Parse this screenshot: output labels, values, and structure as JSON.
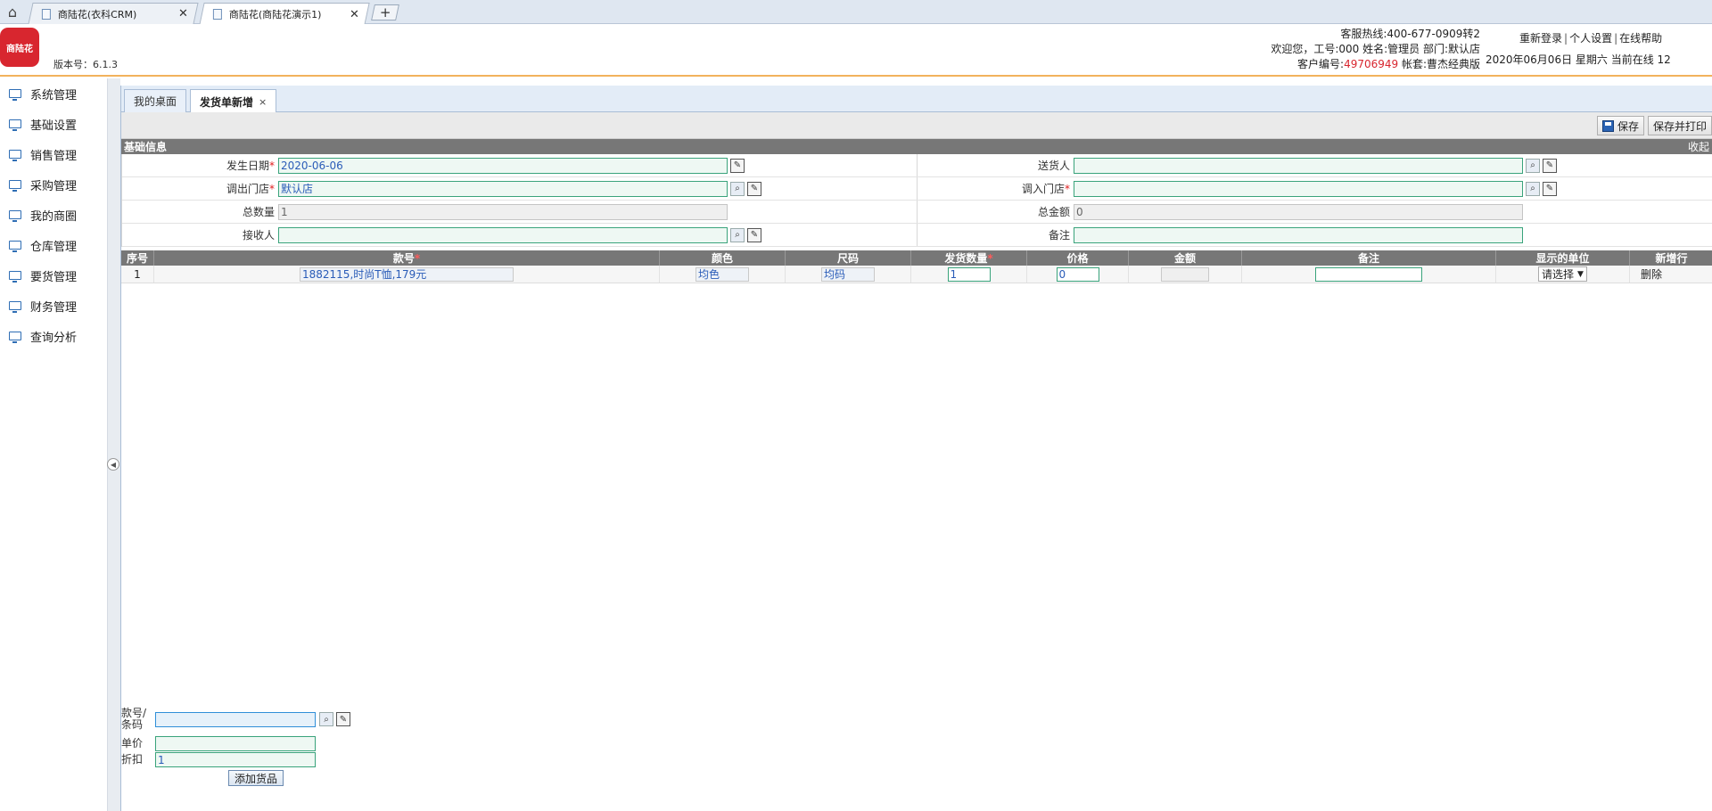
{
  "browser": {
    "tabs": [
      {
        "title": "商陆花(衣科CRM)"
      },
      {
        "title": "商陆花(商陆花演示1)"
      }
    ],
    "new_tab": "+"
  },
  "header": {
    "logo_text": "商陆花",
    "version": "版本号：6.1.3",
    "hotline": "客服热线:400-677-0909转2",
    "welcome": "欢迎您，工号:000 姓名:管理员 部门:默认店",
    "customer_no_label": "客户编号:",
    "customer_no": "49706949",
    "account": " 帐套:曹杰经典版",
    "links": [
      "重新登录",
      "个人设置",
      "在线帮助"
    ],
    "date_line": "2020年06月06日 星期六 当前在线 12"
  },
  "sidebar": {
    "items": [
      "系统管理",
      "基础设置",
      "销售管理",
      "采购管理",
      "我的商圈",
      "仓库管理",
      "要货管理",
      "财务管理",
      "查询分析"
    ]
  },
  "content_tabs": [
    {
      "label": "我的桌面"
    },
    {
      "label": "发货单新增",
      "close": "×"
    }
  ],
  "toolbar": {
    "save_label": "保存",
    "save_print_label": "保存并打印"
  },
  "section": {
    "title": "基础信息",
    "collapse": "收起"
  },
  "form": {
    "date_label": "发生日期",
    "date_value": "2020-06-06",
    "sender_label": "送货人",
    "sender_value": "",
    "out_store_label": "调出门店",
    "out_store_value": "默认店",
    "in_store_label": "调入门店",
    "in_store_value": "",
    "total_qty_label": "总数量",
    "total_qty_value": "1",
    "total_amount_label": "总金额",
    "total_amount_value": "0",
    "receiver_label": "接收人",
    "receiver_value": "",
    "remark_label": "备注",
    "remark_value": "",
    "required_mark": "*"
  },
  "grid": {
    "headers": {
      "seq": "序号",
      "style": "款号",
      "color": "颜色",
      "size": "尺码",
      "qty": "发货数量",
      "price": "价格",
      "amount": "金额",
      "remark": "备注",
      "unit": "显示的单位",
      "addrow": "新增行"
    },
    "rows": [
      {
        "seq": "1",
        "style": "1882115,时尚T恤,179元",
        "color": "均色",
        "size": "均码",
        "qty": "1",
        "price": "0",
        "amount": "",
        "remark": "",
        "unit": "请选择",
        "action": "删除"
      }
    ]
  },
  "add_panel": {
    "code_label": "款号/条码",
    "code_value": "",
    "price_label": "单价",
    "price_value": "",
    "discount_label": "折扣",
    "discount_value": "1",
    "add_button": "添加货品"
  }
}
